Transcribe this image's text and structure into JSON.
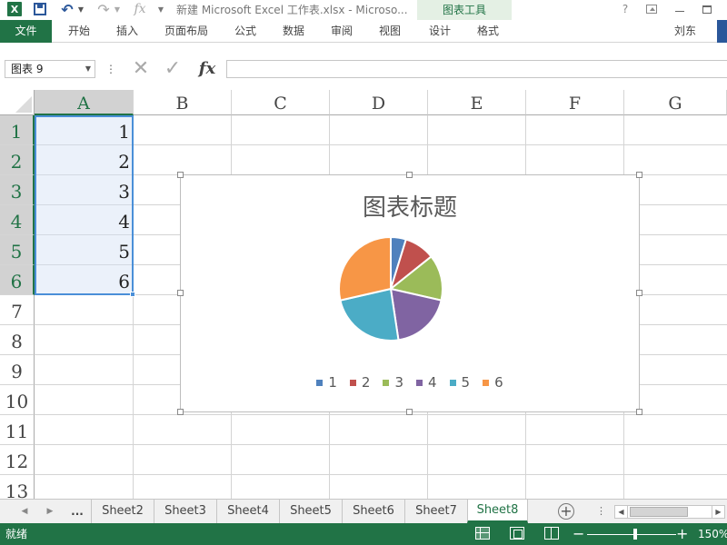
{
  "titlebar": {
    "app_logo": "X",
    "document_title": "新建 Microsoft Excel 工作表.xlsx - Microso...",
    "context_group": "图表工具",
    "help": "?"
  },
  "ribbon": {
    "file_tab": "文件",
    "tabs": [
      "开始",
      "插入",
      "页面布局",
      "公式",
      "数据",
      "审阅",
      "视图"
    ],
    "context_tabs": [
      "设计",
      "格式"
    ],
    "user": "刘东"
  },
  "formula_bar": {
    "name_box": "图表 9",
    "fx": "fx",
    "formula": ""
  },
  "grid": {
    "columns": [
      "A",
      "B",
      "C",
      "D",
      "E",
      "F",
      "G"
    ],
    "rows": [
      "1",
      "2",
      "3",
      "4",
      "5",
      "6",
      "7",
      "8",
      "9",
      "10",
      "11",
      "12",
      "13"
    ],
    "column_a_values": [
      "1",
      "2",
      "3",
      "4",
      "5",
      "6"
    ]
  },
  "chart_data": {
    "type": "pie",
    "title": "图表标题",
    "categories": [
      "1",
      "2",
      "3",
      "4",
      "5",
      "6"
    ],
    "values": [
      1,
      2,
      3,
      4,
      5,
      6
    ],
    "colors": [
      "#4f81bd",
      "#c0504d",
      "#9bbb59",
      "#8064a2",
      "#4bacc6",
      "#f79646"
    ],
    "legend_position": "bottom",
    "separator_color": "#ffffff"
  },
  "sheet_tabs": {
    "more": "...",
    "tabs": [
      "Sheet2",
      "Sheet3",
      "Sheet4",
      "Sheet5",
      "Sheet6",
      "Sheet7",
      "Sheet8"
    ],
    "active": "Sheet8",
    "add": "+"
  },
  "statusbar": {
    "status": "就绪",
    "zoom_minus": "−",
    "zoom_plus": "+",
    "zoom_level": "150%"
  },
  "colors": {
    "excel_green": "#217346",
    "selection_blue": "#4a8fd8"
  }
}
